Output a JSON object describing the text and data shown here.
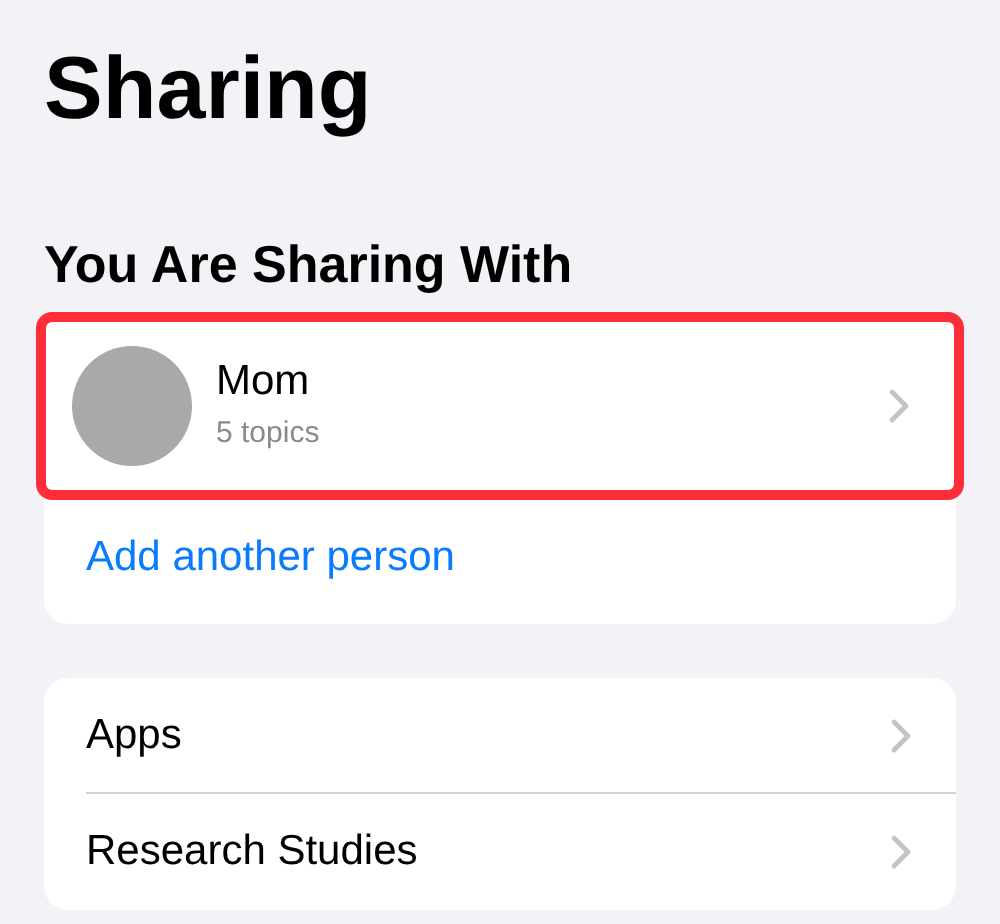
{
  "title": "Sharing",
  "section_header": "You Are Sharing With",
  "people": [
    {
      "name": "Mom",
      "subtitle": "5 topics",
      "highlighted": true
    }
  ],
  "add_link": "Add another person",
  "rows": [
    {
      "label": "Apps"
    },
    {
      "label": "Research Studies"
    }
  ]
}
